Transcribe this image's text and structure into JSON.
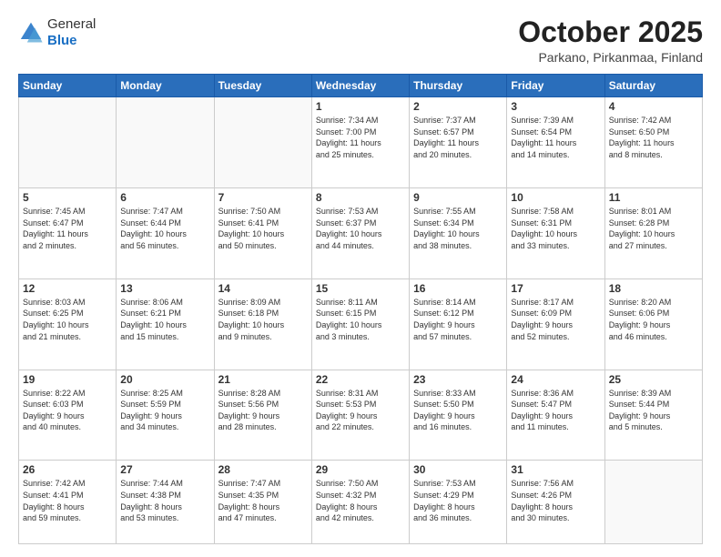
{
  "header": {
    "logo_general": "General",
    "logo_blue": "Blue",
    "month": "October 2025",
    "location": "Parkano, Pirkanmaa, Finland"
  },
  "weekdays": [
    "Sunday",
    "Monday",
    "Tuesday",
    "Wednesday",
    "Thursday",
    "Friday",
    "Saturday"
  ],
  "weeks": [
    [
      {
        "day": "",
        "info": ""
      },
      {
        "day": "",
        "info": ""
      },
      {
        "day": "",
        "info": ""
      },
      {
        "day": "1",
        "info": "Sunrise: 7:34 AM\nSunset: 7:00 PM\nDaylight: 11 hours\nand 25 minutes."
      },
      {
        "day": "2",
        "info": "Sunrise: 7:37 AM\nSunset: 6:57 PM\nDaylight: 11 hours\nand 20 minutes."
      },
      {
        "day": "3",
        "info": "Sunrise: 7:39 AM\nSunset: 6:54 PM\nDaylight: 11 hours\nand 14 minutes."
      },
      {
        "day": "4",
        "info": "Sunrise: 7:42 AM\nSunset: 6:50 PM\nDaylight: 11 hours\nand 8 minutes."
      }
    ],
    [
      {
        "day": "5",
        "info": "Sunrise: 7:45 AM\nSunset: 6:47 PM\nDaylight: 11 hours\nand 2 minutes."
      },
      {
        "day": "6",
        "info": "Sunrise: 7:47 AM\nSunset: 6:44 PM\nDaylight: 10 hours\nand 56 minutes."
      },
      {
        "day": "7",
        "info": "Sunrise: 7:50 AM\nSunset: 6:41 PM\nDaylight: 10 hours\nand 50 minutes."
      },
      {
        "day": "8",
        "info": "Sunrise: 7:53 AM\nSunset: 6:37 PM\nDaylight: 10 hours\nand 44 minutes."
      },
      {
        "day": "9",
        "info": "Sunrise: 7:55 AM\nSunset: 6:34 PM\nDaylight: 10 hours\nand 38 minutes."
      },
      {
        "day": "10",
        "info": "Sunrise: 7:58 AM\nSunset: 6:31 PM\nDaylight: 10 hours\nand 33 minutes."
      },
      {
        "day": "11",
        "info": "Sunrise: 8:01 AM\nSunset: 6:28 PM\nDaylight: 10 hours\nand 27 minutes."
      }
    ],
    [
      {
        "day": "12",
        "info": "Sunrise: 8:03 AM\nSunset: 6:25 PM\nDaylight: 10 hours\nand 21 minutes."
      },
      {
        "day": "13",
        "info": "Sunrise: 8:06 AM\nSunset: 6:21 PM\nDaylight: 10 hours\nand 15 minutes."
      },
      {
        "day": "14",
        "info": "Sunrise: 8:09 AM\nSunset: 6:18 PM\nDaylight: 10 hours\nand 9 minutes."
      },
      {
        "day": "15",
        "info": "Sunrise: 8:11 AM\nSunset: 6:15 PM\nDaylight: 10 hours\nand 3 minutes."
      },
      {
        "day": "16",
        "info": "Sunrise: 8:14 AM\nSunset: 6:12 PM\nDaylight: 9 hours\nand 57 minutes."
      },
      {
        "day": "17",
        "info": "Sunrise: 8:17 AM\nSunset: 6:09 PM\nDaylight: 9 hours\nand 52 minutes."
      },
      {
        "day": "18",
        "info": "Sunrise: 8:20 AM\nSunset: 6:06 PM\nDaylight: 9 hours\nand 46 minutes."
      }
    ],
    [
      {
        "day": "19",
        "info": "Sunrise: 8:22 AM\nSunset: 6:03 PM\nDaylight: 9 hours\nand 40 minutes."
      },
      {
        "day": "20",
        "info": "Sunrise: 8:25 AM\nSunset: 5:59 PM\nDaylight: 9 hours\nand 34 minutes."
      },
      {
        "day": "21",
        "info": "Sunrise: 8:28 AM\nSunset: 5:56 PM\nDaylight: 9 hours\nand 28 minutes."
      },
      {
        "day": "22",
        "info": "Sunrise: 8:31 AM\nSunset: 5:53 PM\nDaylight: 9 hours\nand 22 minutes."
      },
      {
        "day": "23",
        "info": "Sunrise: 8:33 AM\nSunset: 5:50 PM\nDaylight: 9 hours\nand 16 minutes."
      },
      {
        "day": "24",
        "info": "Sunrise: 8:36 AM\nSunset: 5:47 PM\nDaylight: 9 hours\nand 11 minutes."
      },
      {
        "day": "25",
        "info": "Sunrise: 8:39 AM\nSunset: 5:44 PM\nDaylight: 9 hours\nand 5 minutes."
      }
    ],
    [
      {
        "day": "26",
        "info": "Sunrise: 7:42 AM\nSunset: 4:41 PM\nDaylight: 8 hours\nand 59 minutes."
      },
      {
        "day": "27",
        "info": "Sunrise: 7:44 AM\nSunset: 4:38 PM\nDaylight: 8 hours\nand 53 minutes."
      },
      {
        "day": "28",
        "info": "Sunrise: 7:47 AM\nSunset: 4:35 PM\nDaylight: 8 hours\nand 47 minutes."
      },
      {
        "day": "29",
        "info": "Sunrise: 7:50 AM\nSunset: 4:32 PM\nDaylight: 8 hours\nand 42 minutes."
      },
      {
        "day": "30",
        "info": "Sunrise: 7:53 AM\nSunset: 4:29 PM\nDaylight: 8 hours\nand 36 minutes."
      },
      {
        "day": "31",
        "info": "Sunrise: 7:56 AM\nSunset: 4:26 PM\nDaylight: 8 hours\nand 30 minutes."
      },
      {
        "day": "",
        "info": ""
      }
    ]
  ]
}
